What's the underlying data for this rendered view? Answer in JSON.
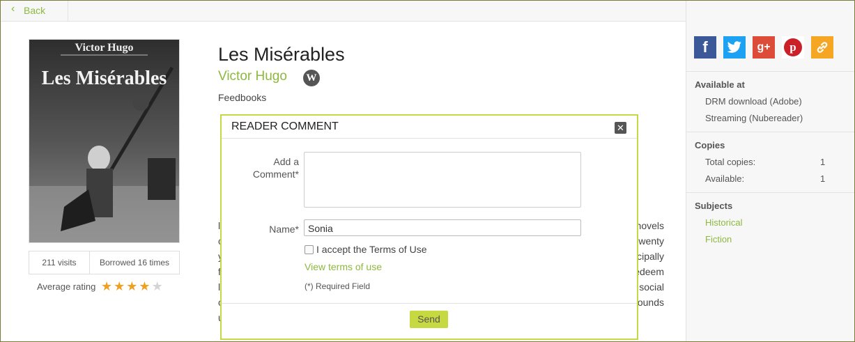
{
  "topbar": {
    "back_label": "Back",
    "back_icon": "chevron-left-icon"
  },
  "book": {
    "title": "Les Misérables",
    "author": "Victor Hugo",
    "wiki_icon": "W",
    "publisher": "Feedbooks",
    "cover": {
      "author": "Victor Hugo",
      "title": "Les Misérables"
    },
    "stats": {
      "visits": "211 visits",
      "borrowed": "Borrowed 16 times"
    },
    "rating": {
      "label": "Average rating",
      "value": 4,
      "max": 5
    },
    "description_fragments_right": [
      "novels",
      "wenty",
      "cipally",
      "edeem",
      "social",
      "ounds"
    ]
  },
  "modal": {
    "title": "READER COMMENT",
    "comment_label_line1": "Add a",
    "comment_label_line2": "Comment*",
    "comment_value": "",
    "name_label": "Name*",
    "name_value": "Sonia",
    "accept_label": "I accept the Terms of Use",
    "accept_checked": false,
    "terms_link": "View terms of use",
    "required_note": "(*) Required Field",
    "send_label": "Send"
  },
  "sidebar": {
    "share_icons": [
      "facebook-icon",
      "twitter-icon",
      "google-plus-icon",
      "pinterest-icon",
      "link-icon"
    ],
    "available_at": {
      "heading": "Available at",
      "items": [
        "DRM download (Adobe)",
        "Streaming (Nubereader)"
      ]
    },
    "copies": {
      "heading": "Copies",
      "total_label": "Total copies:",
      "total_value": "1",
      "available_label": "Available:",
      "available_value": "1"
    },
    "subjects": {
      "heading": "Subjects",
      "items": [
        "Historical",
        "Fiction"
      ]
    }
  },
  "colors": {
    "accent": "#8db93e",
    "modal_border": "#c6d940",
    "star": "#f0a020"
  }
}
